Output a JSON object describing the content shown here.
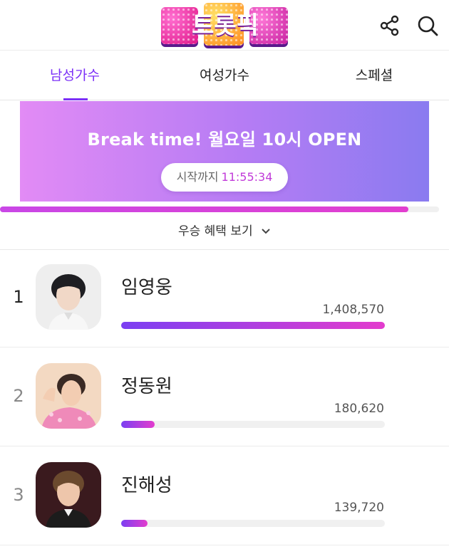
{
  "header": {
    "logo_text": "트롯픽",
    "share_icon": "share-icon",
    "search_icon": "search-icon"
  },
  "tabs": [
    {
      "label": "남성가수",
      "active": true
    },
    {
      "label": "여성가수",
      "active": false
    },
    {
      "label": "스페셜",
      "active": false
    }
  ],
  "banner": {
    "title": "Break time! 월요일 10시 OPEN",
    "countdown_label": "시작까지",
    "countdown_time": "11:55:34",
    "progress_fraction": 0.93
  },
  "benefit": {
    "label": "우승 혜택 보기",
    "icon": "chevron-down-icon"
  },
  "rankings": [
    {
      "rank": "1",
      "name": "임영웅",
      "votes": "1,408,570",
      "fill_fraction": 1.0
    },
    {
      "rank": "2",
      "name": "정동원",
      "votes": "180,620",
      "fill_fraction": 0.128
    },
    {
      "rank": "3",
      "name": "진해성",
      "votes": "139,720",
      "fill_fraction": 0.099
    }
  ],
  "colors": {
    "accent": "#7b2ff7",
    "banner_start": "#e28bf5",
    "banner_end": "#8a7bf0",
    "countdown_time": "#c13ad9",
    "bar_start": "#7b3ff2",
    "bar_end": "#e33ccd"
  }
}
